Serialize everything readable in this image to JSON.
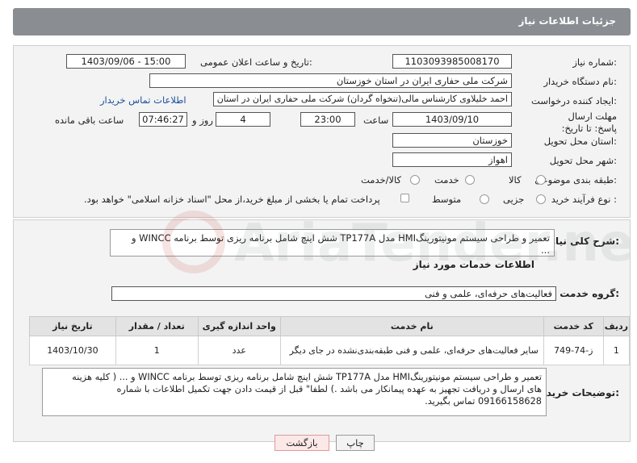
{
  "header": {
    "title": "جزئیات اطلاعات نیاز"
  },
  "fields": {
    "need_number_label": "شماره نیاز:",
    "need_number_value": "1103093985008170",
    "announce_label": "تاریخ و ساعت اعلان عمومی:",
    "announce_value": "1403/09/06 - 15:00",
    "buyer_org_label": "نام دستگاه خریدار:",
    "buyer_org_value": "شرکت ملی حفاری ایران در استان خوزستان",
    "requester_label": "ایجاد کننده درخواست:",
    "requester_value": "احمد خلیلاوی کارشناس مالی(تنخواه گردان) شرکت ملی حفاری ایران در استان",
    "contact_link": "اطلاعات تماس خریدار",
    "deadline_label": "مهلت ارسال پاسخ: تا تاریخ:",
    "deadline_date": "1403/09/10",
    "time_label": "ساعت",
    "deadline_time": "23:00",
    "days_value": "4",
    "days_label": "روز و",
    "remaining_time": "07:46:27",
    "remaining_label": "ساعت باقی مانده",
    "province_label": "استان محل تحویل:",
    "province_value": "خوزستان",
    "city_label": "شهر محل تحویل:",
    "city_value": "اهواز",
    "category_label": "طبقه بندی موضوعی:",
    "category_options": [
      "کالا",
      "خدمت",
      "کالا/خدمت"
    ],
    "process_label": "نوع فرآیند خرید :",
    "process_options": [
      "جزیی",
      "متوسط"
    ],
    "treasury_note": "پرداخت تمام یا بخشی از مبلغ خرید،از محل \"اسناد خزانه اسلامی\" خواهد بود."
  },
  "summary": {
    "label": "شرح کلی نیاز:",
    "line1": "تعمیر و طراحی سیستم مونیتورینگHMI مدل  TP177A  شش اینچ شامل برنامه ریزی توسط برنامه WINCC و",
    "line2": "..."
  },
  "services": {
    "section_title": "اطلاعات خدمات مورد نیاز",
    "group_label": "گروه خدمت:",
    "group_value": "فعالیت‌های حرفه‌ای، علمی و فنی",
    "columns": [
      "ردیف",
      "کد خدمت",
      "نام خدمت",
      "واحد اندازه گیری",
      "تعداد / مقدار",
      "تاریخ نیاز"
    ],
    "rows": [
      {
        "row": "1",
        "code": "ز-74-749",
        "name": "سایر فعالیت‌های حرفه‌ای، علمی و فنی طبقه‌بندی‌نشده در جای دیگر",
        "unit": "عدد",
        "qty": "1",
        "date": "1403/10/30"
      }
    ]
  },
  "buyer_notes": {
    "label": "توضیحات خریدار:",
    "line1": "تعمیر و طراحی سیستم مونیتورینگHMI مدل  TP177A  شش اینچ شامل برنامه ریزی توسط برنامه WINCC و ... ( کلیه هزینه",
    "line2": "های ارسال و دریافت تجهیز به عهده پیمانکار می باشد .) لطفا\" قبل از قیمت دادن جهت تکمیل اطلاعات با شماره",
    "line3": "09166158628 تماس بگیرید."
  },
  "buttons": {
    "print": "چاپ",
    "back": "بازگشت"
  },
  "watermark_text": "AriaTender.neT"
}
